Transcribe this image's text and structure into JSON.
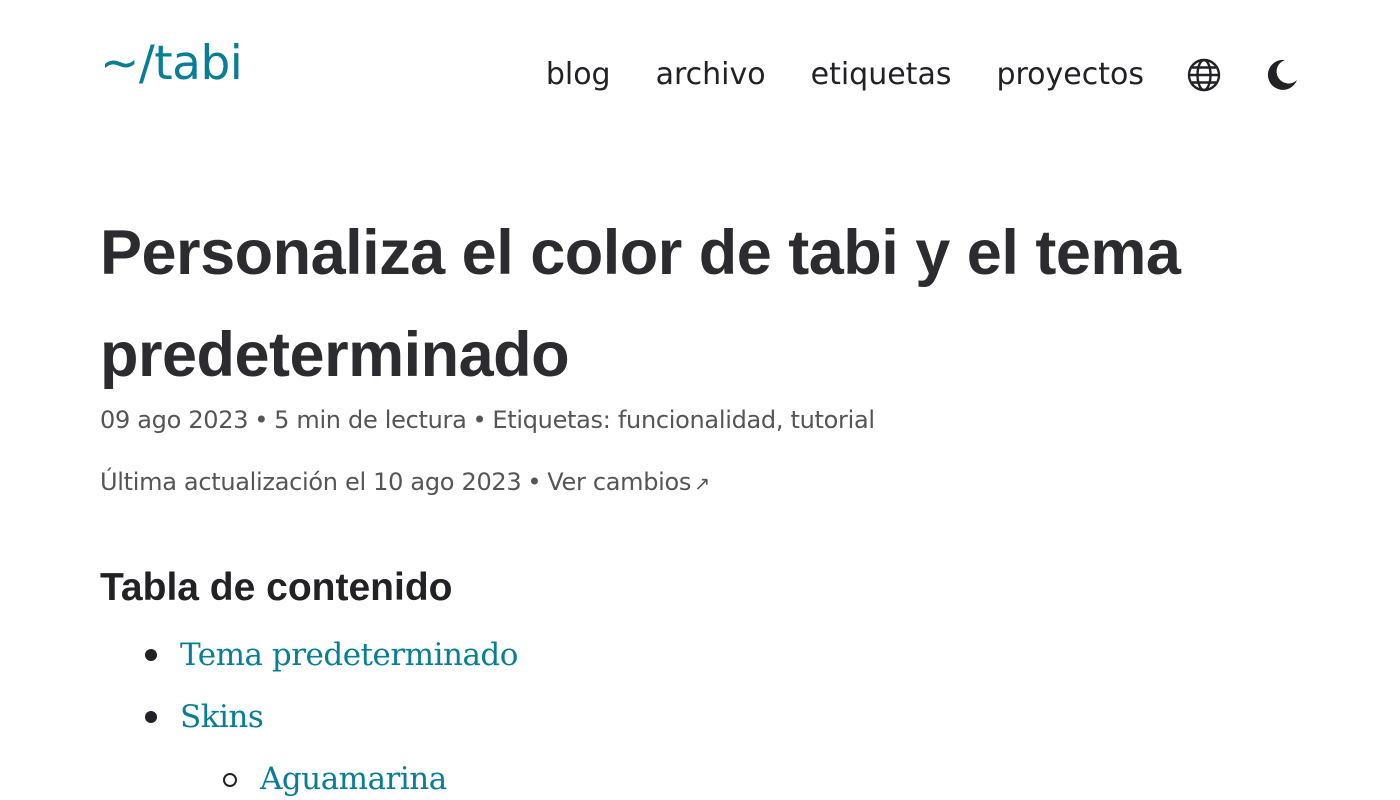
{
  "header": {
    "logo": "~/tabi",
    "nav": [
      {
        "label": "blog"
      },
      {
        "label": "archivo"
      },
      {
        "label": "etiquetas"
      },
      {
        "label": "proyectos"
      }
    ],
    "icons": [
      "globe-icon",
      "moon-icon"
    ]
  },
  "article": {
    "title": "Personaliza el color de tabi y el tema predeterminado",
    "date": "09 ago 2023",
    "separator": "•",
    "reading_time": "5 min de lectura",
    "tags_label": "Etiquetas:",
    "tags": [
      "funcionalidad",
      "tutorial"
    ],
    "tags_joiner": ",",
    "updated_text": "Última actualización el 10 ago 2023",
    "changes_link": "Ver cambios",
    "changes_arrow": "↗"
  },
  "toc": {
    "heading": "Tabla de contenido",
    "items": [
      {
        "label": "Tema predeterminado",
        "level": 1
      },
      {
        "label": "Skins",
        "level": 1
      },
      {
        "label": "Aguamarina",
        "level": 2
      }
    ]
  },
  "colors": {
    "accent": "#087e96",
    "text": "#222226",
    "meta": "#555558"
  }
}
